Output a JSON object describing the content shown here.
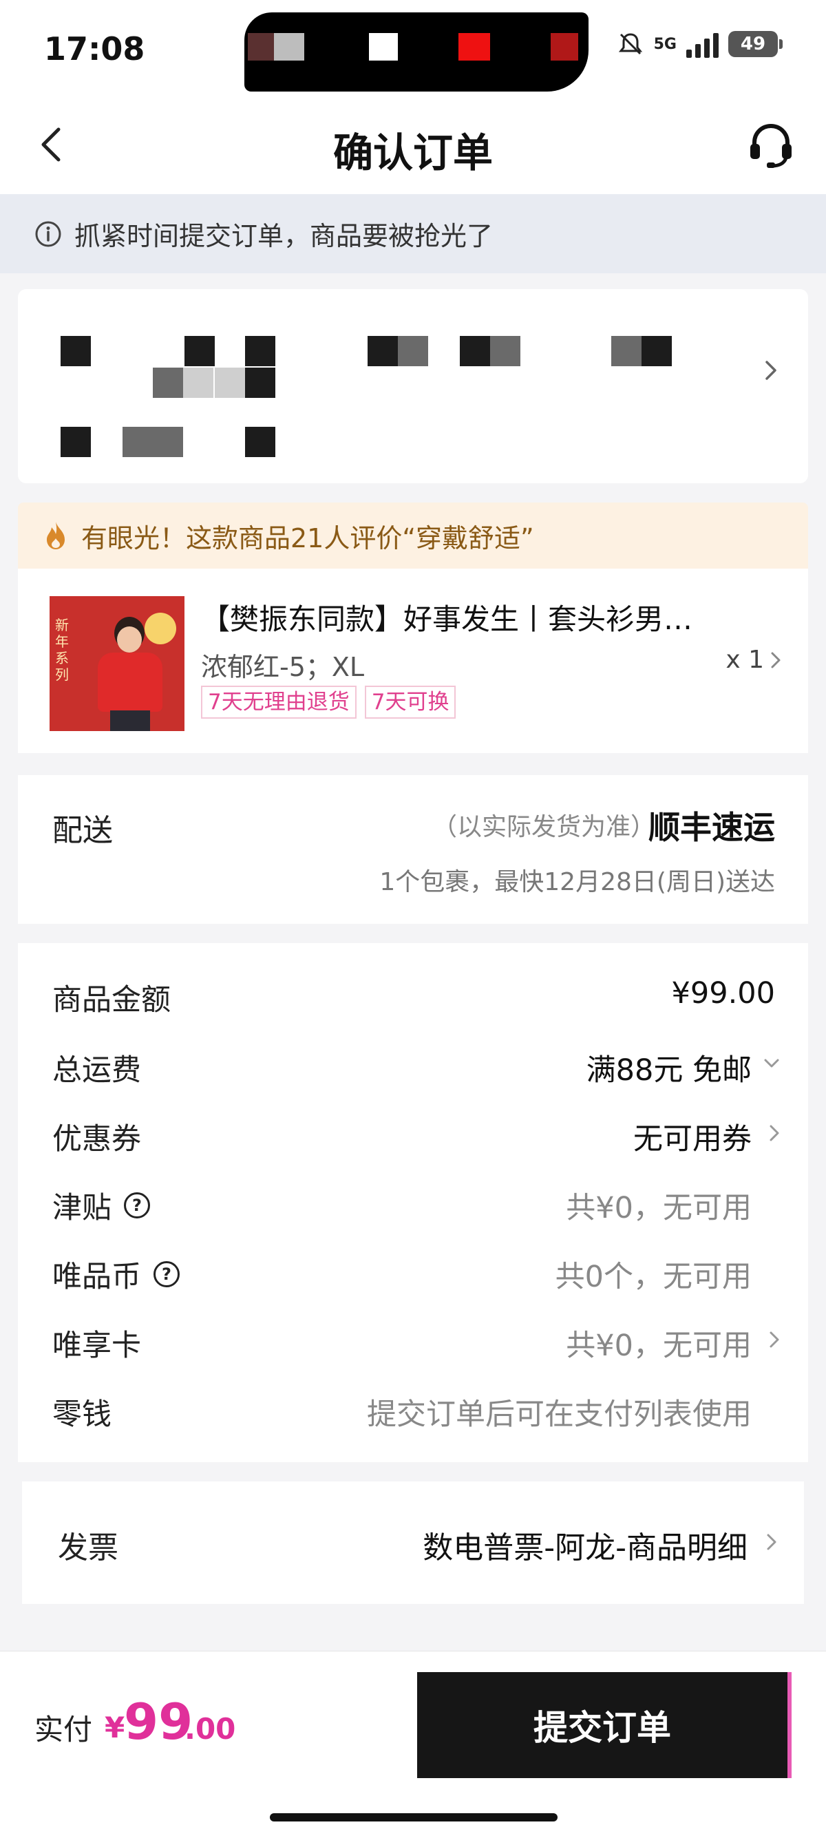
{
  "status_bar": {
    "time": "17:08",
    "network": "5G",
    "battery": "49"
  },
  "nav": {
    "title": "确认订单"
  },
  "notice": {
    "text": "抓紧时间提交订单，商品要被抢光了"
  },
  "tip": {
    "text": "有眼光！这款商品21人评价“穿戴舒适”"
  },
  "product": {
    "title": "【樊振东同款】好事发生丨套头衫男…",
    "spec": "浓郁红-5；XL",
    "quantity": "x 1",
    "tags": [
      "7天无理由退货",
      "7天可换"
    ],
    "thumb_text": "新年系列"
  },
  "delivery": {
    "label": "配送",
    "hint": "（以实际发货为准）",
    "carrier": "顺丰速运",
    "eta": "1个包裹，最快12月28日(周日)送达"
  },
  "price_rows": [
    {
      "label": "商品金额",
      "value": "¥99.00"
    },
    {
      "label": "总运费",
      "value": "满88元 免邮"
    },
    {
      "label": "优惠券",
      "value": "无可用券"
    },
    {
      "label": "津贴",
      "value": "共¥0，无可用"
    },
    {
      "label": "唯品币",
      "value": "共0个，无可用"
    },
    {
      "label": "唯享卡",
      "value": "共¥0，无可用"
    },
    {
      "label": "零钱",
      "value": "提交订单后可在支付列表使用"
    }
  ],
  "invoice": {
    "label": "发票",
    "value": "数电普票-阿龙-商品明细"
  },
  "footer": {
    "pay_label": "实付",
    "currency": "¥",
    "amount_int": "99",
    "amount_dec": ".00",
    "submit_label": "提交订单"
  },
  "colors": {
    "accent": "#e0309a",
    "tip_text": "#8a5a16",
    "tag_text": "#e0408e"
  }
}
